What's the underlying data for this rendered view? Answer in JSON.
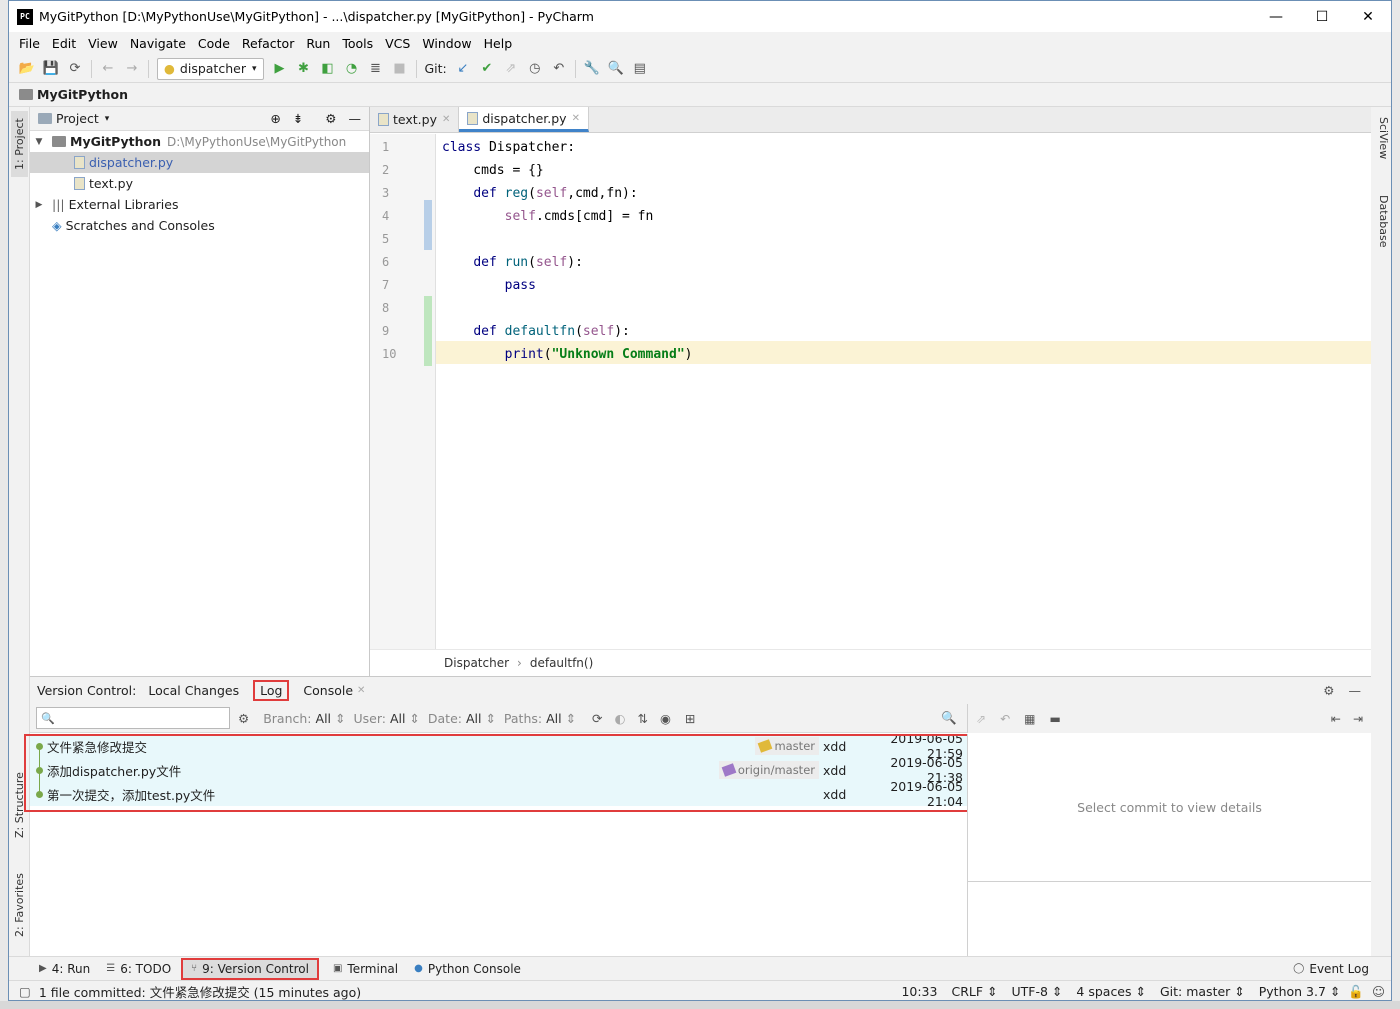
{
  "window": {
    "title": "MyGitPython [D:\\MyPythonUse\\MyGitPython] - ...\\dispatcher.py [MyGitPython] - PyCharm",
    "app_icon_text": "PC"
  },
  "menu": [
    "File",
    "Edit",
    "View",
    "Navigate",
    "Code",
    "Refactor",
    "Run",
    "Tools",
    "VCS",
    "Window",
    "Help"
  ],
  "toolbar": {
    "run_config": "dispatcher",
    "git_label": "Git:"
  },
  "breadcrumb": {
    "project_name": "MyGitPython"
  },
  "left_strip": {
    "project": "1: Project",
    "structure": "Z: Structure",
    "favorites": "2: Favorites"
  },
  "right_strip": {
    "sciview": "SciView",
    "database": "Database"
  },
  "project_panel": {
    "header": "Project",
    "root": {
      "name": "MyGitPython",
      "path": "D:\\MyPythonUse\\MyGitPython"
    },
    "files": [
      "dispatcher.py",
      "text.py"
    ],
    "external": "External Libraries",
    "scratches": "Scratches and Consoles"
  },
  "editor": {
    "tabs": [
      "text.py",
      "dispatcher.py"
    ],
    "line_numbers": [
      "1",
      "2",
      "3",
      "4",
      "5",
      "6",
      "7",
      "8",
      "9",
      "10"
    ],
    "crumbs": [
      "Dispatcher",
      "defaultfn()"
    ]
  },
  "vc_panel": {
    "title": "Version Control:",
    "tabs": [
      "Local Changes",
      "Log",
      "Console"
    ],
    "filters": {
      "branch": "Branch:",
      "branch_val": "All",
      "user": "User:",
      "user_val": "All",
      "date": "Date:",
      "date_val": "All",
      "paths": "Paths:",
      "paths_val": "All"
    },
    "commits": [
      {
        "msg": "文件紧急修改提交",
        "ref": "master",
        "author": "xdd",
        "date": "2019-06-05 21:59"
      },
      {
        "msg": "添加dispatcher.py文件",
        "ref": "origin/master",
        "author": "xdd",
        "date": "2019-06-05 21:38"
      },
      {
        "msg": "第一次提交，添加test.py文件",
        "ref": "",
        "author": "xdd",
        "date": "2019-06-05 21:04"
      }
    ],
    "details_placeholder": "Select commit to view details"
  },
  "bottom_tabs": {
    "run": "4: Run",
    "todo": "6: TODO",
    "vc": "9: Version Control",
    "terminal": "Terminal",
    "python_console": "Python Console",
    "event_log": "Event Log"
  },
  "status": {
    "message": "1 file committed: 文件紧急修改提交 (15 minutes ago)",
    "position": "10:33",
    "line_sep": "CRLF",
    "encoding": "UTF-8",
    "indent": "4 spaces",
    "git": "Git: master",
    "interpreter": "Python 3.7"
  },
  "colors": {
    "accent": "#4083c9",
    "highlight_box": "#e03c3c",
    "commit_row_bg": "#e8f8fb"
  }
}
